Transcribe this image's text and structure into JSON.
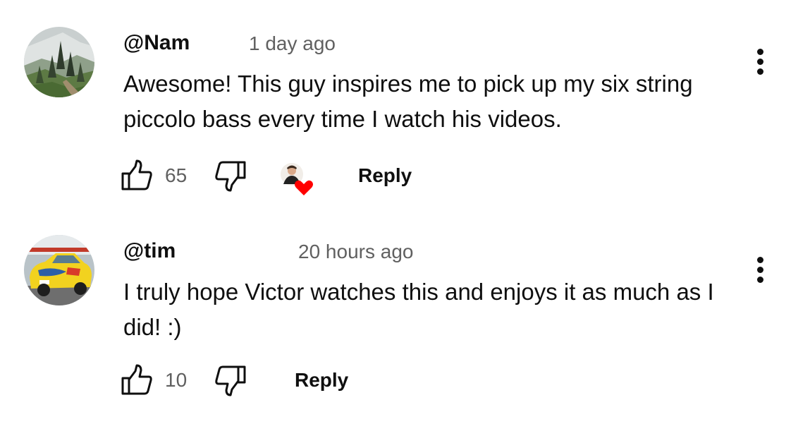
{
  "comments": [
    {
      "author": "@Nam",
      "time": "1 day ago",
      "text": "Awesome! This guy inspires me to pick up my six string piccolo bass every time I watch his videos.",
      "likes": "65",
      "reply_label": "Reply",
      "creator_hearted": true,
      "avatar_icon": "mountain-forest-photo",
      "menu_icon": "more-vert-icon"
    },
    {
      "author": "@tim",
      "time": "20 hours ago",
      "text": "I truly hope Victor watches this and enjoys it as much as I did! :)",
      "likes": "10",
      "reply_label": "Reply",
      "creator_hearted": false,
      "avatar_icon": "yellow-race-car-photo",
      "menu_icon": "more-vert-icon"
    }
  ],
  "colors": {
    "text": "#0f0f0f",
    "secondary_text": "#606060",
    "heart": "#ff0000",
    "background": "#ffffff"
  }
}
